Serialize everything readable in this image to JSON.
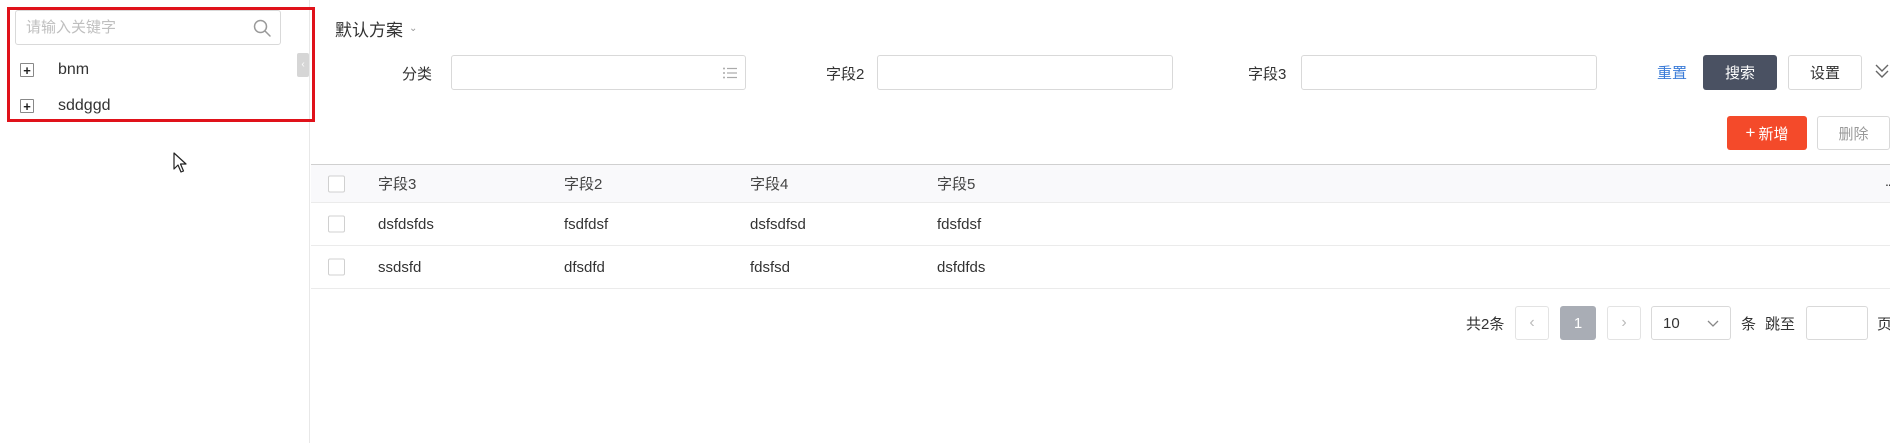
{
  "sidebar": {
    "search": {
      "placeholder": "请输入关键字",
      "value": ""
    },
    "tree": [
      {
        "label": "bnm",
        "toggle": "+"
      },
      {
        "label": "sddggd",
        "toggle": "+"
      }
    ],
    "collapse_glyph": "‹"
  },
  "header": {
    "scheme_label": "默认方案",
    "scheme_chevron": "⌄"
  },
  "filters": {
    "field1_label": "分类",
    "field2_label": "字段2",
    "field3_label": "字段3",
    "field1_value": "",
    "field2_value": "",
    "field3_value": ""
  },
  "actions": {
    "reset_label": "重置",
    "search_label": "搜索",
    "settings_label": "设置",
    "add_label": "新增",
    "add_plus": "+",
    "delete_label": "删除"
  },
  "table": {
    "columns": [
      "字段3",
      "字段2",
      "字段4",
      "字段5"
    ],
    "more_glyph": "··",
    "rows": [
      [
        "dsfdsfds",
        "fsdfdsf",
        "dsfsdfsd",
        "fdsfdsf"
      ],
      [
        "ssdsfd",
        "dfsdfd",
        "fdsfsd",
        "dsfdfds"
      ]
    ]
  },
  "pagination": {
    "total_text": "共2条",
    "prev_glyph": "‹",
    "next_glyph": "›",
    "current_page": "1",
    "page_size": "10",
    "per_unit": "条",
    "jump_label": "跳至",
    "page_unit": "页",
    "jump_value": ""
  },
  "colors": {
    "highlight": "#e0121a",
    "primary_dark": "#4a5162",
    "add_red": "#f44a2a",
    "link_blue": "#3b7cd8"
  }
}
